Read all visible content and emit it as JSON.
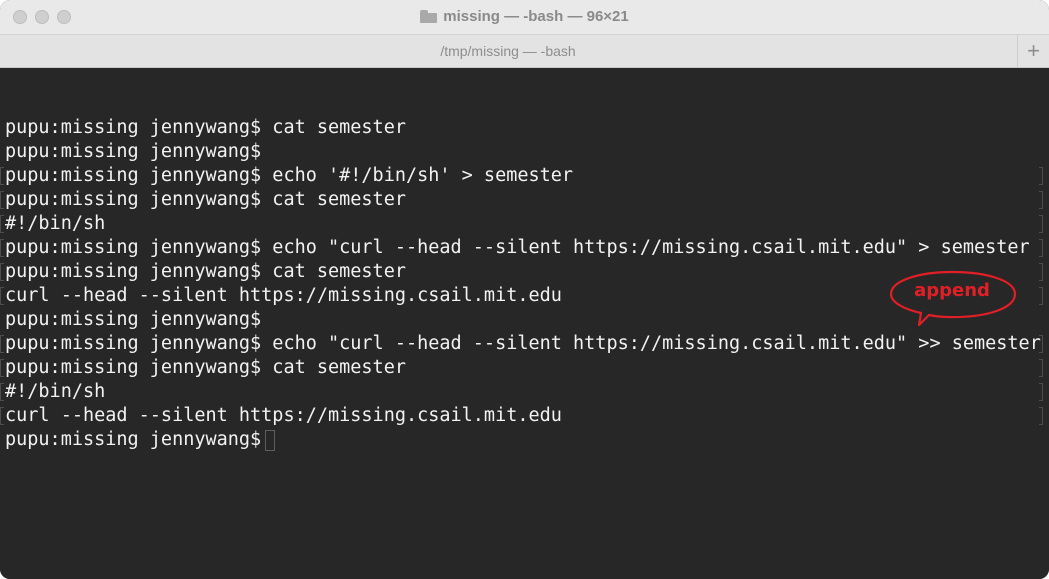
{
  "window": {
    "title": "missing — -bash — 96×21",
    "tab_label": "/tmp/missing — -bash",
    "new_tab_glyph": "+",
    "folder_icon": "folder-icon"
  },
  "terminal": {
    "lines": [
      "pupu:missing jennywang$ cat semester",
      "pupu:missing jennywang$",
      "pupu:missing jennywang$ echo '#!/bin/sh' > semester",
      "pupu:missing jennywang$ cat semester",
      "#!/bin/sh",
      "pupu:missing jennywang$ echo \"curl --head --silent https://missing.csail.mit.edu\" > semester",
      "pupu:missing jennywang$ cat semester",
      "curl --head --silent https://missing.csail.mit.edu",
      "pupu:missing jennywang$",
      "pupu:missing jennywang$ echo \"curl --head --silent https://missing.csail.mit.edu\" >> semester",
      "pupu:missing jennywang$ cat semester",
      "#!/bin/sh",
      "curl --head --silent https://missing.csail.mit.edu",
      "pupu:missing jennywang$ "
    ]
  },
  "annotation": {
    "text": "append",
    "color": "#e11f26"
  },
  "colors": {
    "terminal_bg": "#272727",
    "terminal_fg": "#f2f2f2",
    "titlebar_bg": "#e9e9e9"
  }
}
